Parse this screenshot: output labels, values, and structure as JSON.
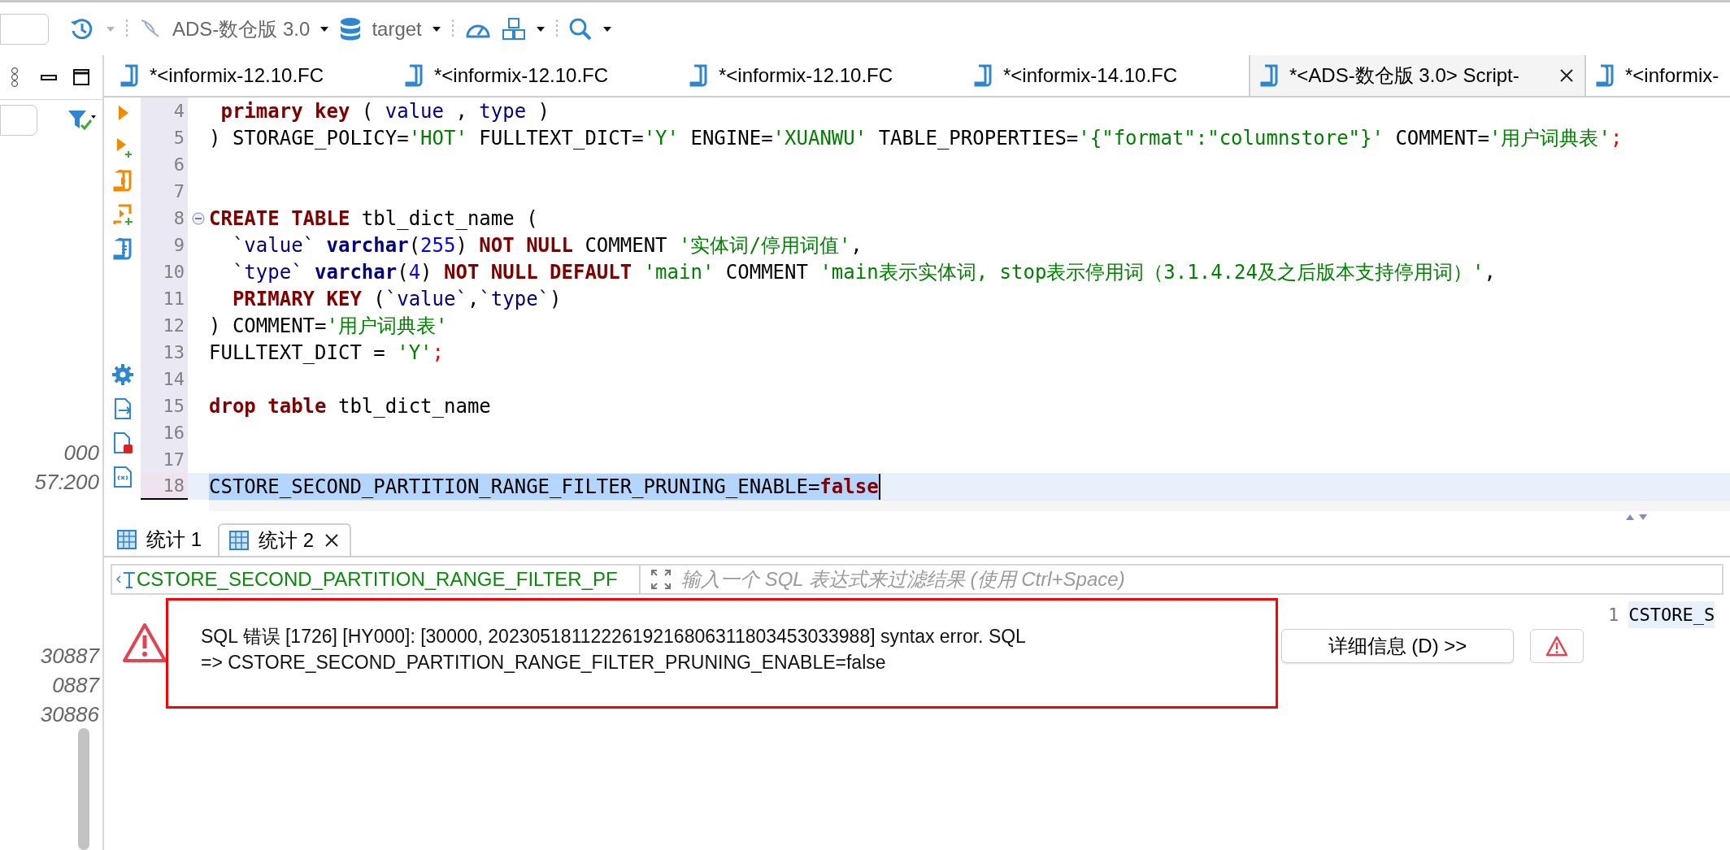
{
  "toolbar": {
    "connection": "ADS-数仓版 3.0",
    "database": "target"
  },
  "left_panel": {
    "groups": [
      {
        "lines": [
          "000",
          "57:200"
        ]
      },
      {
        "lines": [
          "30887",
          "0887",
          "30886"
        ]
      }
    ]
  },
  "editor_tabs": [
    {
      "label": "*<informix-12.10.FC",
      "selected": false
    },
    {
      "label": "*<informix-12.10.FC",
      "selected": false
    },
    {
      "label": "*<informix-12.10.FC",
      "selected": false
    },
    {
      "label": "*<informix-14.10.FC",
      "selected": false
    },
    {
      "label": "*<ADS-数仓版 3.0> Script-",
      "selected": true
    },
    {
      "label": "*<informix-",
      "selected": false
    }
  ],
  "lines": [
    {
      "number": "4",
      "selected": false,
      "foldable": false,
      "tokens": [
        {
          "kind": "kw",
          "text": " primary key"
        },
        {
          "kind": "plain",
          "text": " ( "
        },
        {
          "kind": "id",
          "text": "value"
        },
        {
          "kind": "plain",
          "text": " , "
        },
        {
          "kind": "id",
          "text": "type"
        },
        {
          "kind": "plain",
          "text": " )"
        }
      ]
    },
    {
      "number": "5",
      "selected": false,
      "foldable": false,
      "tokens": [
        {
          "kind": "plain",
          "text": ") STORAGE_POLICY="
        },
        {
          "kind": "str",
          "text": "'HOT'"
        },
        {
          "kind": "plain",
          "text": " FULLTEXT_DICT="
        },
        {
          "kind": "str",
          "text": "'Y'"
        },
        {
          "kind": "plain",
          "text": " ENGINE="
        },
        {
          "kind": "str",
          "text": "'XUANWU'"
        },
        {
          "kind": "plain",
          "text": " TABLE_PROPERTIES="
        },
        {
          "kind": "str",
          "text": "'{\"format\":\"columnstore\"}'"
        },
        {
          "kind": "plain",
          "text": " COMMENT="
        },
        {
          "kind": "str",
          "text": "'用户词典表'"
        },
        {
          "kind": "err",
          "text": ";"
        }
      ]
    },
    {
      "number": "6",
      "selected": false,
      "foldable": false
    },
    {
      "number": "7",
      "selected": false,
      "foldable": false
    },
    {
      "number": "8",
      "selected": false,
      "foldable": true,
      "tokens": [
        {
          "kind": "kw",
          "text": "CREATE TABLE"
        },
        {
          "kind": "plain",
          "text": " tbl_dict_name ("
        }
      ]
    },
    {
      "number": "9",
      "selected": false,
      "foldable": false,
      "tokens": [
        {
          "kind": "id",
          "text": "  `value`"
        },
        {
          "kind": "type",
          "text": " varchar"
        },
        {
          "kind": "plain",
          "text": "("
        },
        {
          "kind": "num",
          "text": "255"
        },
        {
          "kind": "plain",
          "text": ") "
        },
        {
          "kind": "kw",
          "text": "NOT NULL"
        },
        {
          "kind": "plain",
          "text": " COMMENT "
        },
        {
          "kind": "str",
          "text": "'实体词/停用词值'"
        },
        {
          "kind": "plain",
          "text": ","
        }
      ]
    },
    {
      "number": "10",
      "selected": false,
      "foldable": false,
      "tokens": [
        {
          "kind": "id",
          "text": "  `type`"
        },
        {
          "kind": "type",
          "text": " varchar"
        },
        {
          "kind": "plain",
          "text": "("
        },
        {
          "kind": "num",
          "text": "4"
        },
        {
          "kind": "plain",
          "text": ") "
        },
        {
          "kind": "kw",
          "text": "NOT NULL DEFAULT"
        },
        {
          "kind": "str",
          "text": " 'main'"
        },
        {
          "kind": "plain",
          "text": " COMMENT "
        },
        {
          "kind": "str",
          "text": "'main表示实体词, stop表示停用词（3.1.4.24及之后版本支持停用词）'"
        },
        {
          "kind": "plain",
          "text": ","
        }
      ]
    },
    {
      "number": "11",
      "selected": false,
      "foldable": false,
      "tokens": [
        {
          "kind": "kw",
          "text": "  PRIMARY KEY"
        },
        {
          "kind": "plain",
          "text": " ("
        },
        {
          "kind": "id",
          "text": "`value`"
        },
        {
          "kind": "plain",
          "text": ","
        },
        {
          "kind": "id",
          "text": "`type`"
        },
        {
          "kind": "plain",
          "text": ")"
        }
      ]
    },
    {
      "number": "12",
      "selected": false,
      "foldable": false,
      "tokens": [
        {
          "kind": "plain",
          "text": ") COMMENT="
        },
        {
          "kind": "str",
          "text": "'用户词典表'"
        }
      ]
    },
    {
      "number": "13",
      "selected": false,
      "foldable": false,
      "tokens": [
        {
          "kind": "plain",
          "text": "FULLTEXT_DICT = "
        },
        {
          "kind": "str",
          "text": "'Y'"
        },
        {
          "kind": "err",
          "text": ";"
        }
      ]
    },
    {
      "number": "14",
      "selected": false,
      "foldable": false
    },
    {
      "number": "15",
      "selected": false,
      "foldable": false,
      "tokens": [
        {
          "kind": "kw",
          "text": "drop table"
        },
        {
          "kind": "plain",
          "text": " tbl_dict_name"
        }
      ]
    },
    {
      "number": "16",
      "selected": false,
      "foldable": false
    },
    {
      "number": "17",
      "selected": false,
      "foldable": false
    },
    {
      "number": "18",
      "selected": true,
      "foldable": false,
      "tokens": [
        {
          "kind": "plain",
          "text": "CSTORE_SECOND_PARTITION_RANGE_FILTER_PRUNING_ENABLE="
        },
        {
          "kind": "kw",
          "text": "false"
        }
      ]
    }
  ],
  "result_tabs": [
    {
      "label": "统计 1",
      "selected": false
    },
    {
      "label": "统计 2",
      "selected": true
    }
  ],
  "filter": {
    "value": "CSTORE_SECOND_PARTITION_RANGE_FILTER_PF",
    "placeholder": "输入一个 SQL 表达式来过滤结果 (使用 Ctrl+Space)"
  },
  "error": {
    "message": "SQL 错误 [1726] [HY000]: [30000, 2023051811222619216806311803453033988] syntax error. SQL\n=> CSTORE_SECOND_PARTITION_RANGE_FILTER_PRUNING_ENABLE=false",
    "details_button": "详细信息 (D) >>"
  },
  "result_grid": {
    "row_number": "1",
    "cell": "CSTORE_S"
  }
}
